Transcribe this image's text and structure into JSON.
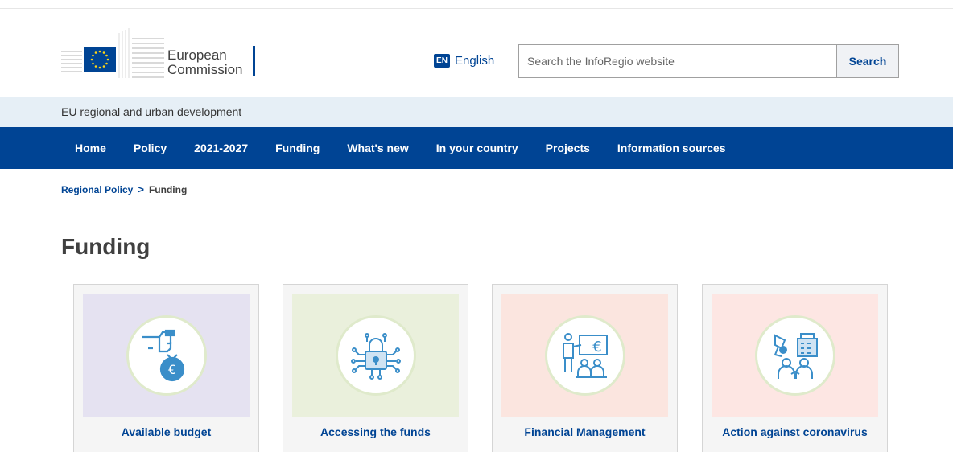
{
  "logo": {
    "line1": "European",
    "line2": "Commission"
  },
  "language": {
    "code": "EN",
    "label": "English"
  },
  "search": {
    "placeholder": "Search the InfoRegio website",
    "button_label": "Search"
  },
  "site_name": "EU regional and urban development",
  "nav": {
    "items": [
      {
        "label": "Home"
      },
      {
        "label": "Policy"
      },
      {
        "label": "2021-2027"
      },
      {
        "label": "Funding"
      },
      {
        "label": "What's new"
      },
      {
        "label": "In your country"
      },
      {
        "label": "Projects"
      },
      {
        "label": "Information sources"
      }
    ]
  },
  "breadcrumb": {
    "parent": "Regional Policy",
    "separator": ">",
    "current": "Funding"
  },
  "page_title": "Funding",
  "cards": [
    {
      "label": "Available budget",
      "icon": "money-bag-hand-icon",
      "bg": "#e5e2f1"
    },
    {
      "label": "Accessing the funds",
      "icon": "padlock-circuit-icon",
      "bg": "#eaf0dc"
    },
    {
      "label": "Financial Management",
      "icon": "presentation-meeting-icon",
      "bg": "#fbe5df"
    },
    {
      "label": "Action against coronavirus",
      "icon": "virus-people-icon",
      "bg": "#fde6e3"
    }
  ],
  "colors": {
    "brand_blue": "#004494",
    "icon_blue": "#3a8ec9",
    "site_band": "#e6eff6"
  }
}
